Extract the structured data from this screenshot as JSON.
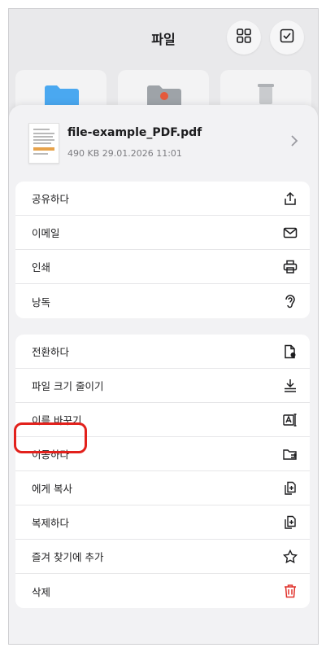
{
  "header": {
    "title": "파일"
  },
  "file": {
    "name": "file-example_PDF.pdf",
    "meta": "490 KB 29.01.2026 11:01"
  },
  "menu_group1": [
    {
      "label": "공유하다",
      "icon": "share-icon"
    },
    {
      "label": "이메일",
      "icon": "mail-icon"
    },
    {
      "label": "인쇄",
      "icon": "printer-icon"
    },
    {
      "label": "낭독",
      "icon": "ear-icon"
    }
  ],
  "menu_group2": [
    {
      "label": "전환하다",
      "icon": "convert-file-icon",
      "highlighted": true
    },
    {
      "label": "파일 크기 줄이기",
      "icon": "compress-icon"
    },
    {
      "label": "이름 바꾸기",
      "icon": "rename-icon"
    },
    {
      "label": "이동하다",
      "icon": "move-folder-icon"
    },
    {
      "label": "에게 복사",
      "icon": "copy-to-icon"
    },
    {
      "label": "복제하다",
      "icon": "duplicate-icon"
    },
    {
      "label": "즐겨 찾기에 추가",
      "icon": "star-icon"
    },
    {
      "label": "삭제",
      "icon": "trash-icon"
    }
  ],
  "colors": {
    "highlight": "#e2211c",
    "delete": "#e0312a",
    "folder_blue": "#4aa8f0"
  }
}
